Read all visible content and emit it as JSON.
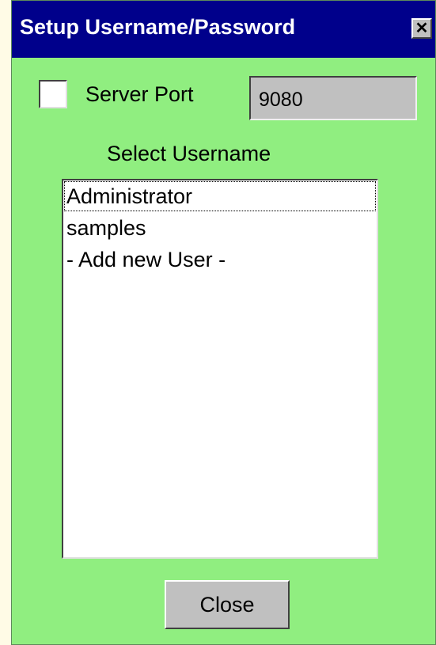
{
  "window": {
    "title": "Setup Username/Password",
    "close_glyph": "✕"
  },
  "server_port": {
    "label": "Server Port",
    "checked": false,
    "value": "9080"
  },
  "username": {
    "label": "Select Username",
    "items": [
      "Administrator",
      "samples",
      "- Add new User -"
    ],
    "focused_item": "Administrator"
  },
  "actions": {
    "close_label": "Close"
  },
  "colors": {
    "title_bar": "#00008b",
    "window_bg": "#90ee80",
    "desktop_bg": "#fffbe6",
    "field_bg": "#c0c0c0"
  }
}
